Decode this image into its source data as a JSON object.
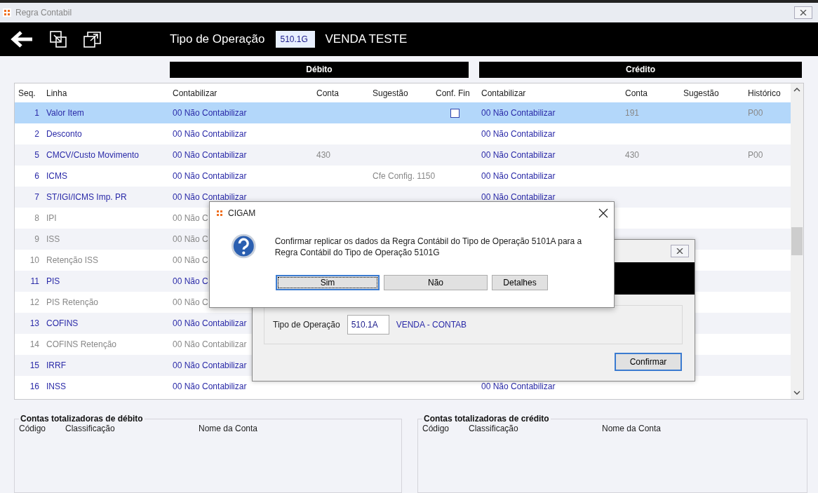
{
  "window": {
    "title": "Regra Contabil"
  },
  "toolbar": {
    "label": "Tipo de Operação",
    "code": "510.1G",
    "description": "VENDA TESTE"
  },
  "sections": [
    "Débito",
    "Crédito"
  ],
  "table": {
    "columns": [
      "Seq.",
      "Linha",
      "Contabilizar",
      "Conta",
      "Sugestão",
      "Conf. Fin",
      "Contabilizar",
      "Conta",
      "Sugestão",
      "Histórico"
    ],
    "rows": [
      {
        "seq": "1",
        "linha": "Valor Item",
        "deb_contabilizar": "00 Não Contabilizar",
        "deb_conta": "",
        "deb_sugestao": "",
        "conf_fin": {
          "checked": false
        },
        "cred_contabilizar": "00 Não Contabilizar",
        "cred_conta": "191",
        "cred_sugestao": "",
        "historico": "P00",
        "disabled": false,
        "selected": true
      },
      {
        "seq": "2",
        "linha": "Desconto",
        "deb_contabilizar": "00 Não Contabilizar",
        "deb_conta": "",
        "deb_sugestao": "",
        "cred_contabilizar": "00 Não Contabilizar",
        "cred_conta": "",
        "cred_sugestao": "",
        "historico": "",
        "disabled": false,
        "selected": false
      },
      {
        "seq": "5",
        "linha": "CMCV/Custo Movimento",
        "deb_contabilizar": "00 Não Contabilizar",
        "deb_conta": "430",
        "deb_sugestao": "",
        "cred_contabilizar": "00 Não Contabilizar",
        "cred_conta": "430",
        "cred_sugestao": "",
        "historico": "P00",
        "disabled": false,
        "selected": false
      },
      {
        "seq": "6",
        "linha": "ICMS",
        "deb_contabilizar": "00 Não Contabilizar",
        "deb_conta": "",
        "deb_sugestao": "Cfe Config. 1150",
        "cred_contabilizar": "00 Não Contabilizar",
        "cred_conta": "",
        "cred_sugestao": "",
        "historico": "",
        "disabled": false,
        "selected": false
      },
      {
        "seq": "7",
        "linha": "ST/IGI/ICMS Imp. PR",
        "deb_contabilizar": "00 Não Contabilizar",
        "deb_conta": "",
        "deb_sugestao": "",
        "cred_contabilizar": "00 Não Contabilizar",
        "cred_conta": "",
        "cred_sugestao": "",
        "historico": "",
        "disabled": false,
        "selected": false
      },
      {
        "seq": "8",
        "linha": "IPI",
        "deb_contabilizar": "00 Não C",
        "deb_conta": "",
        "deb_sugestao": "",
        "cred_contabilizar": "",
        "cred_conta": "",
        "cred_sugestao": "",
        "historico": "",
        "disabled": true,
        "selected": false
      },
      {
        "seq": "9",
        "linha": "ISS",
        "deb_contabilizar": "00 Não C",
        "deb_conta": "",
        "deb_sugestao": "",
        "cred_contabilizar": "",
        "cred_conta": "",
        "cred_sugestao": "",
        "historico": "",
        "disabled": true,
        "selected": false
      },
      {
        "seq": "10",
        "linha": "Retenção ISS",
        "deb_contabilizar": "00 Não C",
        "deb_conta": "",
        "deb_sugestao": "",
        "cred_contabilizar": "",
        "cred_conta": "",
        "cred_sugestao": "",
        "historico": "",
        "disabled": true,
        "selected": false
      },
      {
        "seq": "11",
        "linha": "PIS",
        "deb_contabilizar": "00 Não C",
        "deb_conta": "",
        "deb_sugestao": "",
        "cred_contabilizar": "",
        "cred_conta": "",
        "cred_sugestao": "",
        "historico": "",
        "disabled": false,
        "selected": false
      },
      {
        "seq": "12",
        "linha": "PIS Retenção",
        "deb_contabilizar": "00 Não C",
        "deb_conta": "",
        "deb_sugestao": "",
        "cred_contabilizar": "",
        "cred_conta": "",
        "cred_sugestao": "",
        "historico": "",
        "disabled": true,
        "selected": false
      },
      {
        "seq": "13",
        "linha": "COFINS",
        "deb_contabilizar": "00 Não Contabilizar",
        "deb_conta": "",
        "deb_sugestao": "",
        "cred_contabilizar": "",
        "cred_conta": "",
        "cred_sugestao": "",
        "historico": "",
        "disabled": false,
        "selected": false
      },
      {
        "seq": "14",
        "linha": "COFINS Retenção",
        "deb_contabilizar": "00 Não Contabilizar",
        "deb_conta": "",
        "deb_sugestao": "",
        "cred_contabilizar": "",
        "cred_conta": "",
        "cred_sugestao": "",
        "historico": "",
        "disabled": true,
        "selected": false
      },
      {
        "seq": "15",
        "linha": "IRRF",
        "deb_contabilizar": "00 Não Contabilizar",
        "deb_conta": "",
        "deb_sugestao": "",
        "cred_contabilizar": "",
        "cred_conta": "",
        "cred_sugestao": "",
        "historico": "",
        "disabled": false,
        "selected": false
      },
      {
        "seq": "16",
        "linha": "INSS",
        "deb_contabilizar": "00 Não Contabilizar",
        "deb_conta": "",
        "deb_sugestao": "",
        "cred_contabilizar": "00 Não Contabilizar",
        "cred_conta": "",
        "cred_sugestao": "",
        "historico": "",
        "disabled": false,
        "selected": false
      }
    ]
  },
  "totals": [
    {
      "title": "Contas totalizadoras de débito",
      "columns": [
        "Código",
        "Classificação",
        "Nome da Conta"
      ]
    },
    {
      "title": "Contas totalizadoras de crédito",
      "columns": [
        "Código",
        "Classificação",
        "Nome da Conta"
      ]
    }
  ],
  "replicate_dialog": {
    "field_label": "Tipo de Operação",
    "field_value": "510.1A",
    "field_description": "VENDA - CONTAB",
    "button": "Confirmar"
  },
  "message_box": {
    "title": "CIGAM",
    "message": "Confirmar replicar os dados da Regra Contábil do Tipo de Operação 5101A para a Regra Contábil do Tipo de Operação 5101G",
    "buttons": [
      {
        "label": "Sim",
        "selected": true
      },
      {
        "label": "Não",
        "selected": false
      },
      {
        "label": "Detalhes",
        "selected": false
      }
    ]
  }
}
